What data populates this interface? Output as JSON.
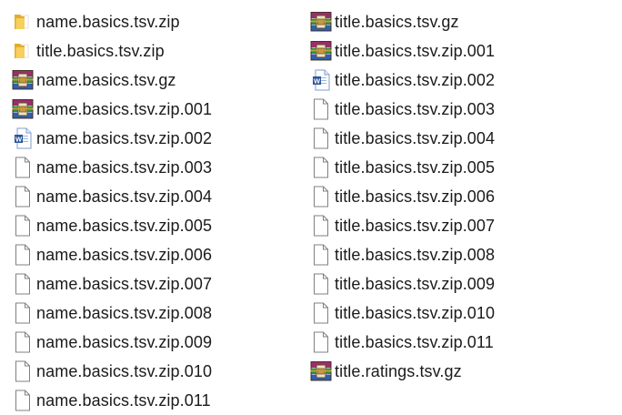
{
  "columns": [
    {
      "items": [
        {
          "name": "name.basics.tsv.zip",
          "icon": "folder-icon"
        },
        {
          "name": "title.basics.tsv.zip",
          "icon": "folder-icon"
        },
        {
          "name": "name.basics.tsv.gz",
          "icon": "winrar-archive-icon"
        },
        {
          "name": "name.basics.tsv.zip.001",
          "icon": "winrar-archive-icon"
        },
        {
          "name": "name.basics.tsv.zip.002",
          "icon": "word-document-icon"
        },
        {
          "name": "name.basics.tsv.zip.003",
          "icon": "blank-file-icon"
        },
        {
          "name": "name.basics.tsv.zip.004",
          "icon": "blank-file-icon"
        },
        {
          "name": "name.basics.tsv.zip.005",
          "icon": "blank-file-icon"
        },
        {
          "name": "name.basics.tsv.zip.006",
          "icon": "blank-file-icon"
        },
        {
          "name": "name.basics.tsv.zip.007",
          "icon": "blank-file-icon"
        },
        {
          "name": "name.basics.tsv.zip.008",
          "icon": "blank-file-icon"
        },
        {
          "name": "name.basics.tsv.zip.009",
          "icon": "blank-file-icon"
        },
        {
          "name": "name.basics.tsv.zip.010",
          "icon": "blank-file-icon"
        },
        {
          "name": "name.basics.tsv.zip.011",
          "icon": "blank-file-icon"
        }
      ]
    },
    {
      "items": [
        {
          "name": "title.basics.tsv.gz",
          "icon": "winrar-archive-icon"
        },
        {
          "name": "title.basics.tsv.zip.001",
          "icon": "winrar-archive-icon"
        },
        {
          "name": "title.basics.tsv.zip.002",
          "icon": "word-document-icon"
        },
        {
          "name": "title.basics.tsv.zip.003",
          "icon": "blank-file-icon"
        },
        {
          "name": "title.basics.tsv.zip.004",
          "icon": "blank-file-icon"
        },
        {
          "name": "title.basics.tsv.zip.005",
          "icon": "blank-file-icon"
        },
        {
          "name": "title.basics.tsv.zip.006",
          "icon": "blank-file-icon"
        },
        {
          "name": "title.basics.tsv.zip.007",
          "icon": "blank-file-icon"
        },
        {
          "name": "title.basics.tsv.zip.008",
          "icon": "blank-file-icon"
        },
        {
          "name": "title.basics.tsv.zip.009",
          "icon": "blank-file-icon"
        },
        {
          "name": "title.basics.tsv.zip.010",
          "icon": "blank-file-icon"
        },
        {
          "name": "title.basics.tsv.zip.011",
          "icon": "blank-file-icon"
        },
        {
          "name": "title.ratings.tsv.gz",
          "icon": "winrar-archive-icon"
        }
      ]
    }
  ],
  "colors": {
    "folder": "#f3c64f",
    "word_blue": "#2b579a",
    "text": "#1b1b1b"
  }
}
